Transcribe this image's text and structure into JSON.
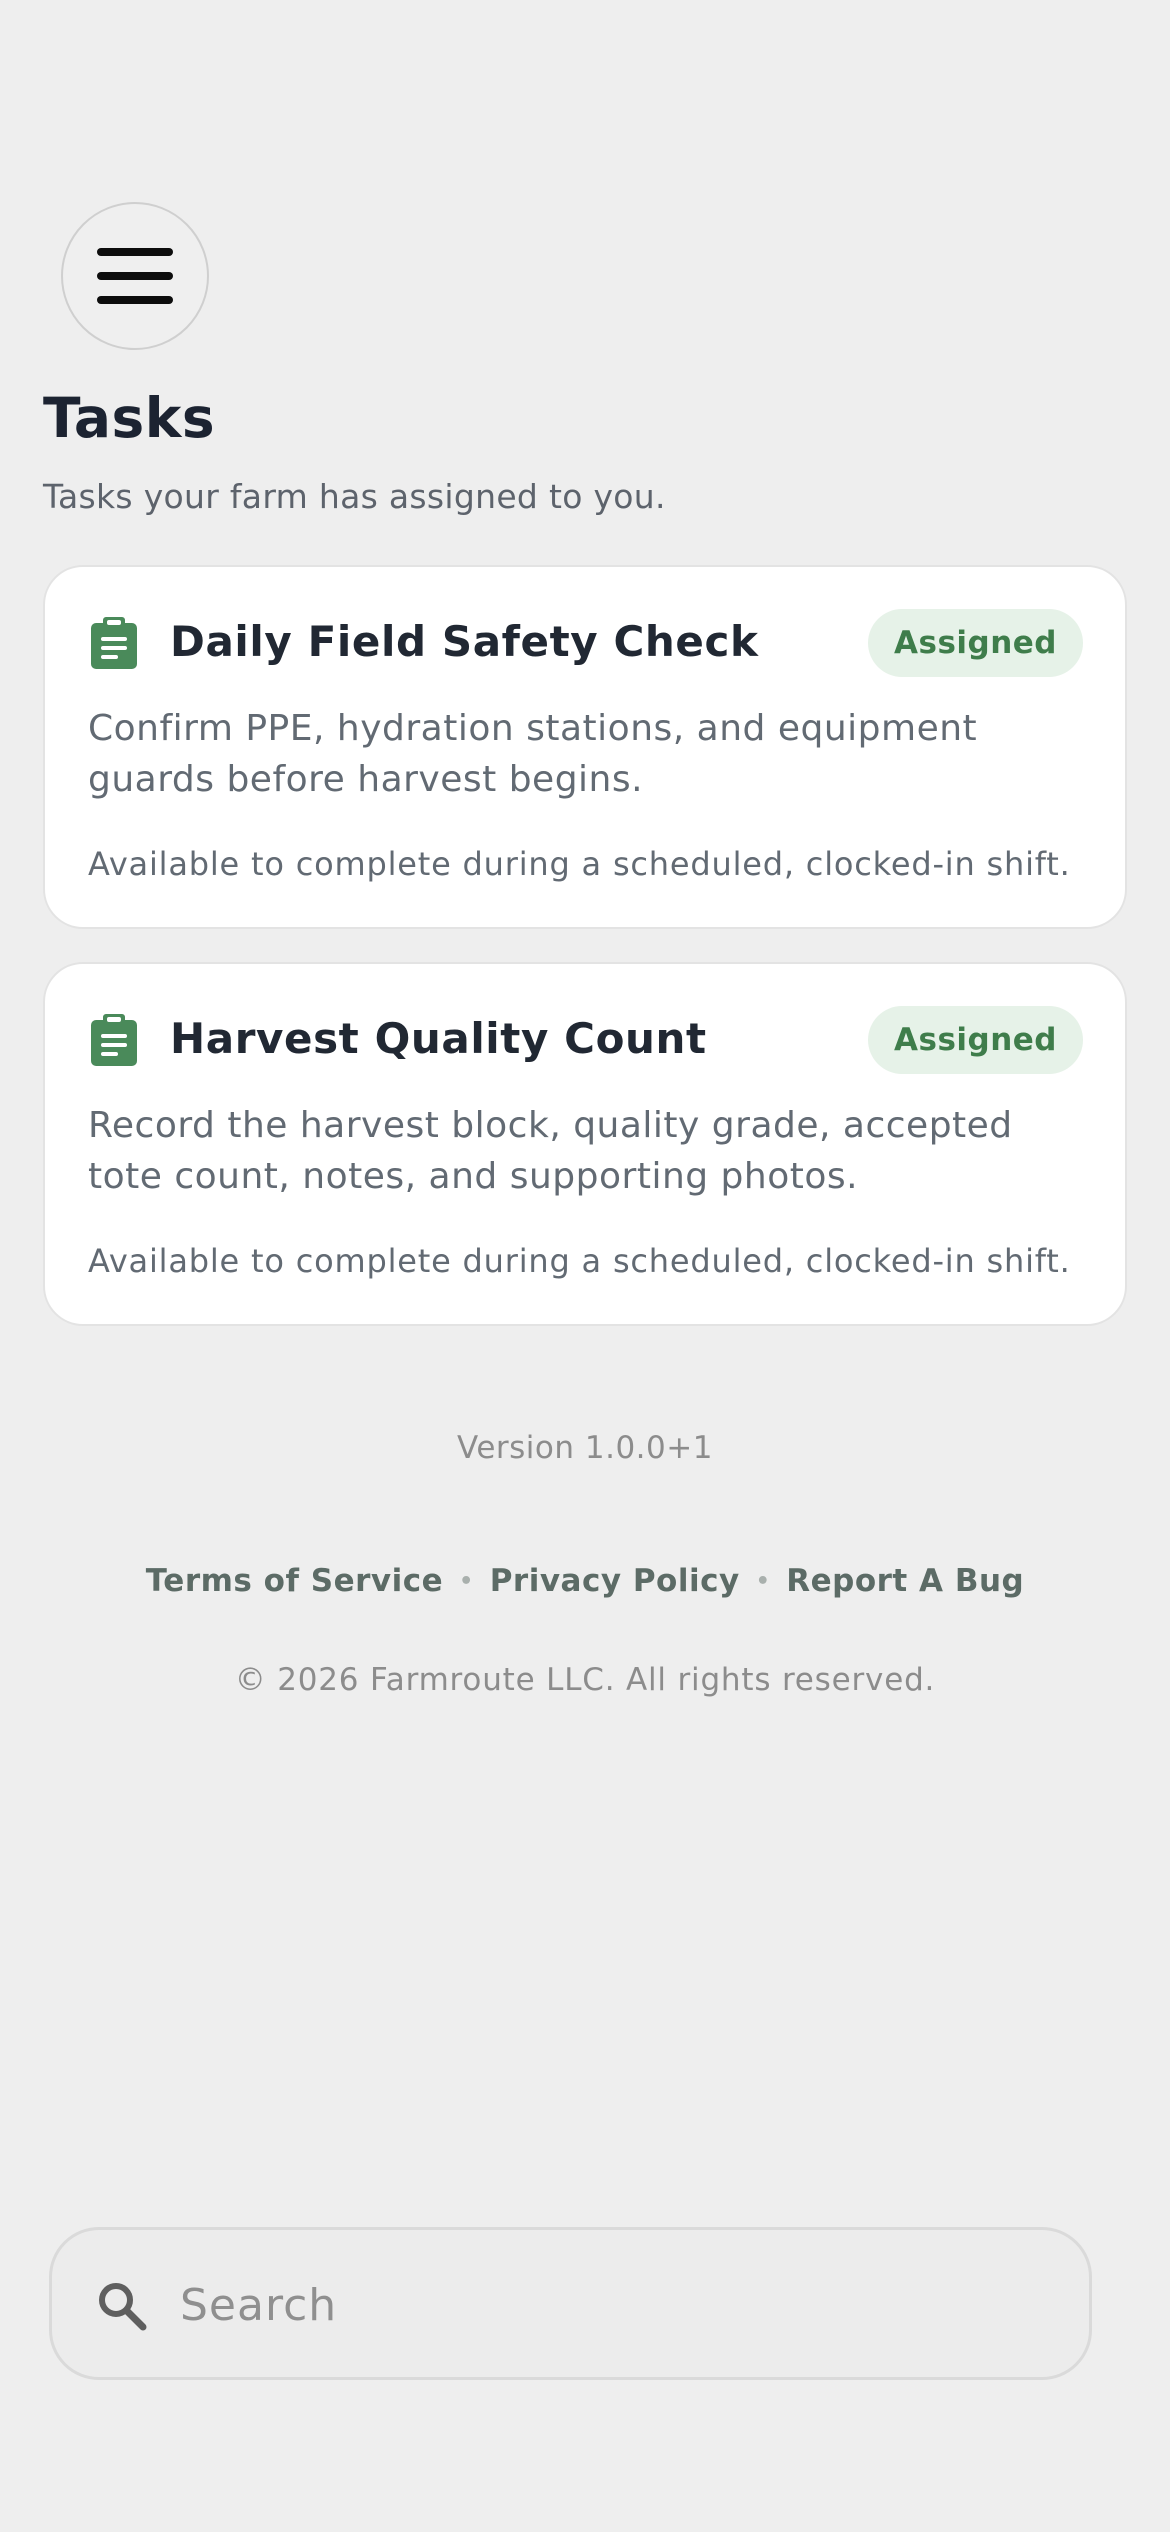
{
  "header": {
    "menu_icon": "hamburger-menu-icon",
    "title": "Tasks",
    "subtitle": "Tasks your farm has assigned to you."
  },
  "tasks": [
    {
      "icon": "clipboard-icon",
      "title": "Daily Field Safety Check",
      "status": "Assigned",
      "description": "Confirm PPE, hydration stations, and equipment guards before harvest begins.",
      "note": "Available to complete during a scheduled, clocked-in shift."
    },
    {
      "icon": "clipboard-icon",
      "title": "Harvest Quality Count",
      "status": "Assigned",
      "description": "Record the harvest block, quality grade, accepted tote count, notes, and supporting photos.",
      "note": "Available to complete during a scheduled, clocked-in shift."
    }
  ],
  "footer": {
    "version": "Version 1.0.0+1",
    "links": [
      "Terms of Service",
      "Privacy Policy",
      "Report A Bug"
    ],
    "separator": "•",
    "copyright": "© 2026 Farmroute LLC. All rights reserved."
  },
  "search": {
    "placeholder": "Search",
    "value": "",
    "icon": "search-icon"
  },
  "colors": {
    "background": "#eeeeee",
    "accent_green": "#4a8a5a",
    "badge_bg": "#e6f2e8",
    "badge_text": "#3f7d4b",
    "title_text": "#1c2331",
    "body_text": "#626a73"
  }
}
